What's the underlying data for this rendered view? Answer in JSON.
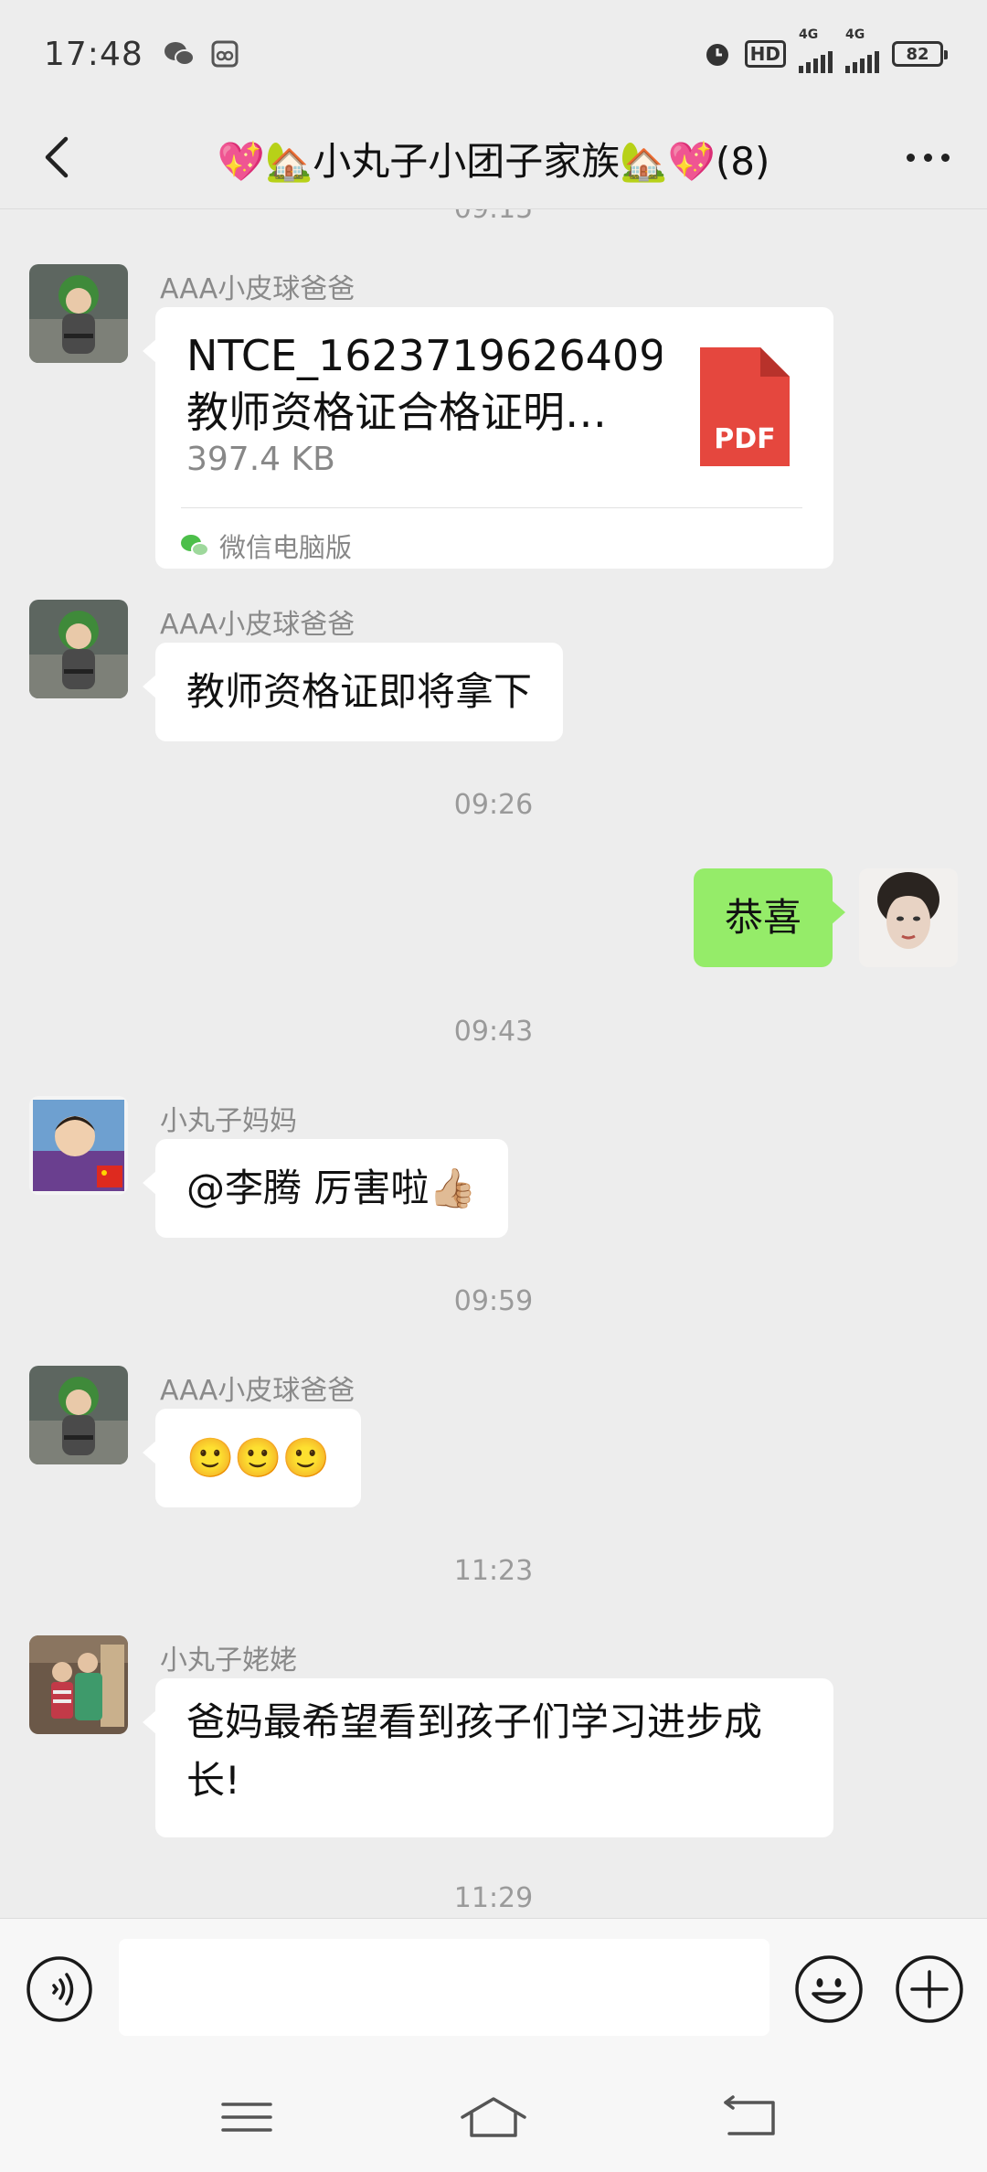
{
  "status_bar": {
    "time": "17:48",
    "hd_label": "HD",
    "network1": "4G",
    "network2": "4G",
    "battery": "82"
  },
  "header": {
    "title": "💖🏡小丸子小团子家族🏡💖(8)"
  },
  "messages": {
    "partial_time": "09:15",
    "m1": {
      "sender": "AAA小皮球爸爸",
      "file_name_line1": "NTCE_1623719626409",
      "file_name_line2": "教师资格证合格证明…",
      "file_size": "397.4 KB",
      "file_type": "PDF",
      "source": "微信电脑版"
    },
    "m2": {
      "sender": "AAA小皮球爸爸",
      "text": "教师资格证即将拿下"
    },
    "t1": "09:26",
    "m3": {
      "text": "恭喜"
    },
    "t2": "09:43",
    "m4": {
      "sender": "小丸子妈妈",
      "text": "@李腾  厉害啦👍🏼"
    },
    "t3": "09:59",
    "m5": {
      "sender": "AAA小皮球爸爸",
      "text": "🙂🙂🙂"
    },
    "t4": "11:23",
    "m6": {
      "sender": "小丸子姥姥",
      "line1": "爸妈最希望看到孩子们学习进步成",
      "line2": "长!"
    },
    "t5": "11:29"
  },
  "colors": {
    "background": "#EDEDED",
    "bubble_self": "#95EC69",
    "bubble_other": "#FFFFFF",
    "pdf_red": "#E5473E",
    "timestamp": "#9A9A9A"
  },
  "icons": [
    "back-arrow-icon",
    "more-icon",
    "pdf-icon",
    "wechat-icon",
    "voice-icon",
    "emoji-icon",
    "plus-icon",
    "menu-icon",
    "home-icon",
    "back-nav-icon"
  ]
}
